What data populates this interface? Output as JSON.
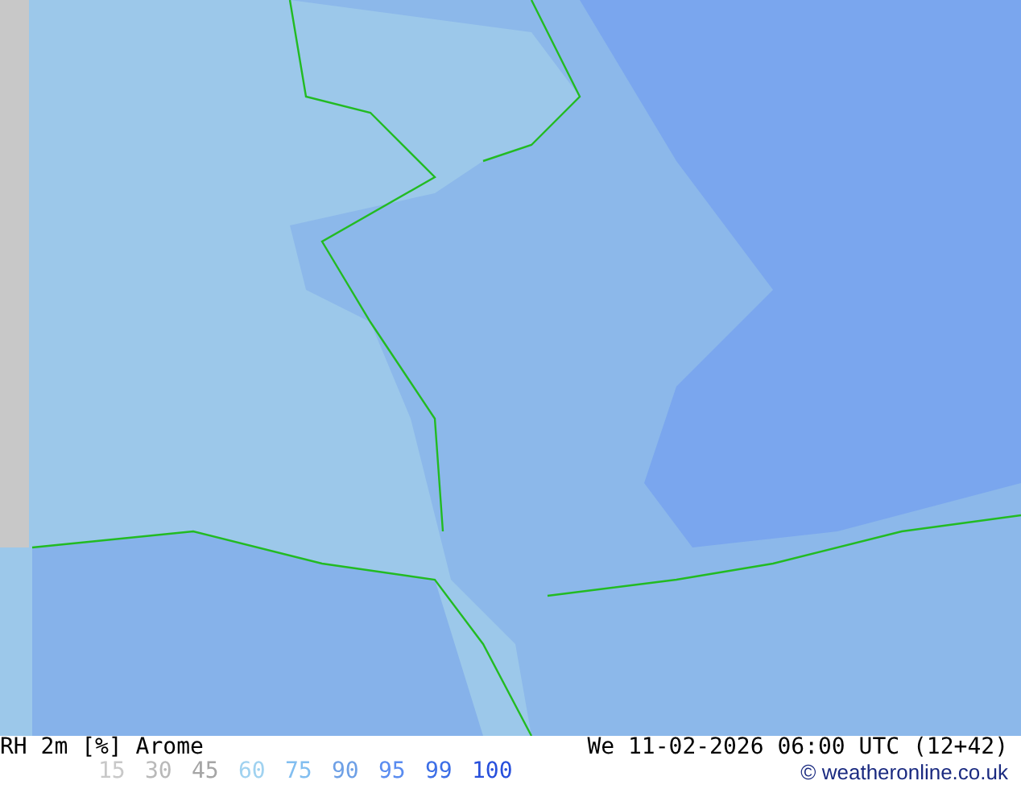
{
  "map": {
    "kind": "map"
  },
  "footer": {
    "title": "RH 2m [%] Arome",
    "datetime": "We 11-02-2026 06:00 UTC (12+42)",
    "copyright": "© weatheronline.co.uk",
    "legend": [
      {
        "label": "15",
        "color": "#c8c8c8"
      },
      {
        "label": "30",
        "color": "#b9b9b9"
      },
      {
        "label": "45",
        "color": "#a5a5a5"
      },
      {
        "label": "60",
        "color": "#a0d2f0"
      },
      {
        "label": "75",
        "color": "#82bef0"
      },
      {
        "label": "90",
        "color": "#6ea0e6"
      },
      {
        "label": "95",
        "color": "#5a8cf0"
      },
      {
        "label": "99",
        "color": "#3c6ee6"
      },
      {
        "label": "100",
        "color": "#2850dc"
      }
    ]
  }
}
